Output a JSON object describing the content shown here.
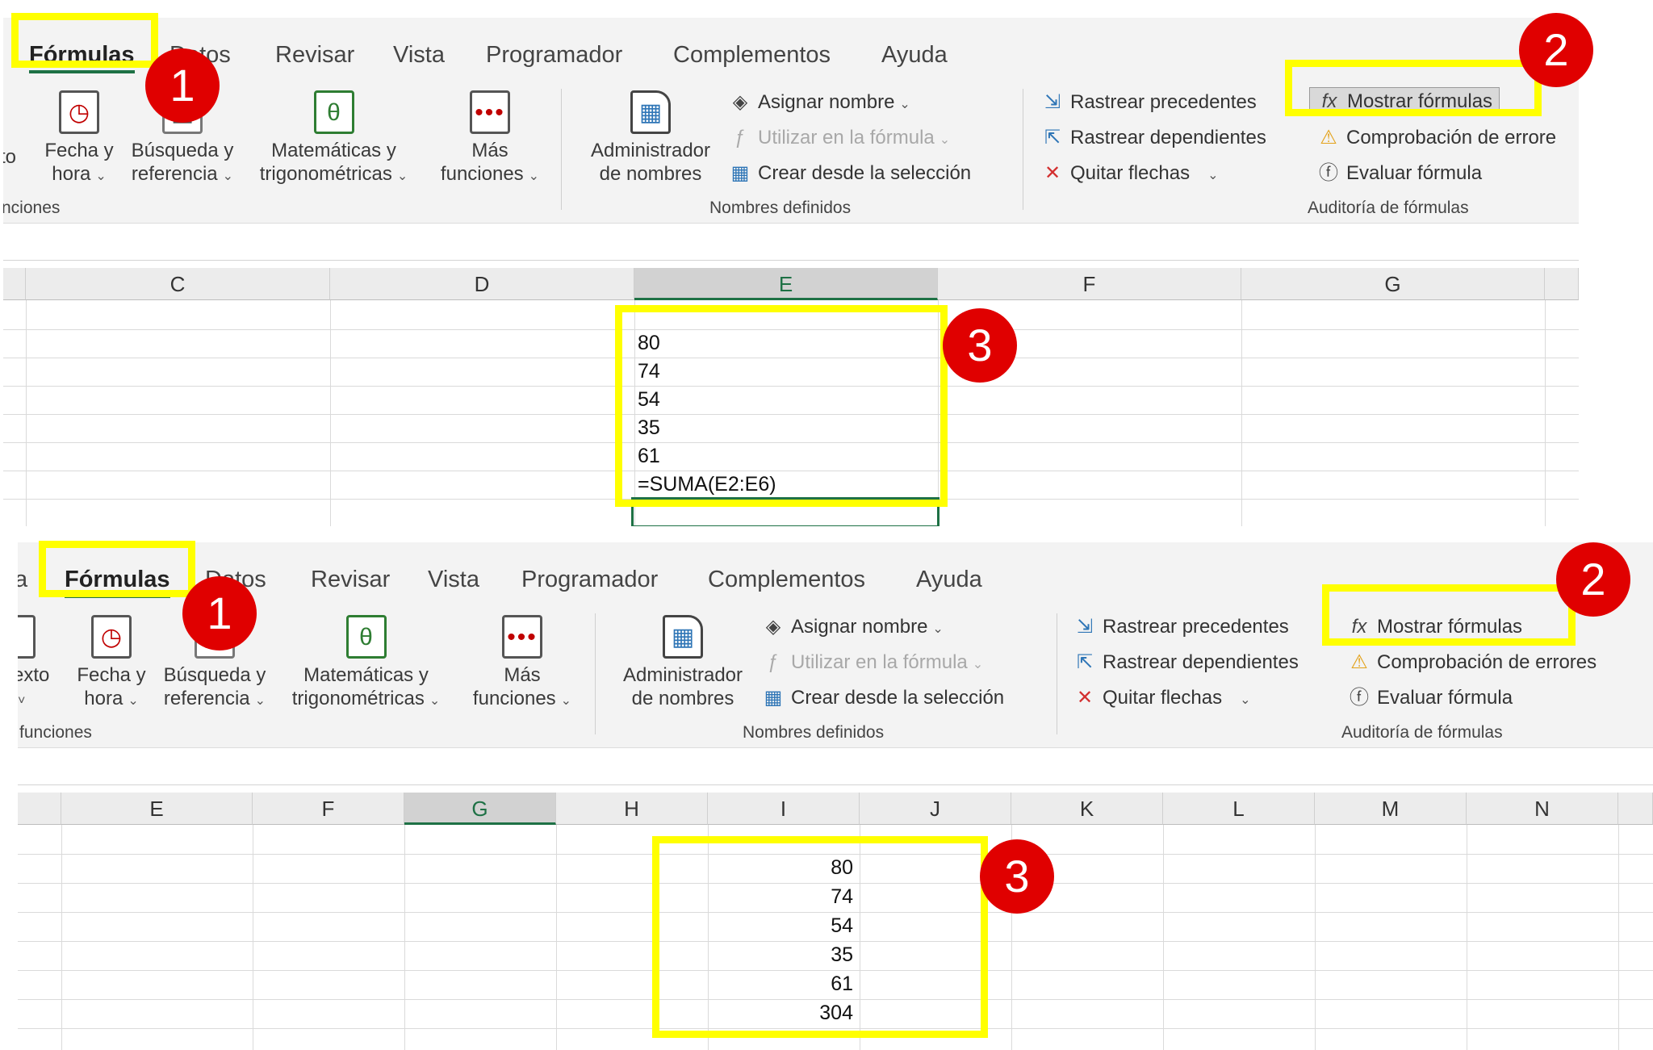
{
  "top": {
    "tabs": [
      "Fórmulas",
      "Datos",
      "Revisar",
      "Vista",
      "Programador",
      "Complementos",
      "Ayuda"
    ],
    "functions_group": {
      "partial_left_label": "to",
      "fecha": [
        "Fecha y",
        "hora"
      ],
      "busqueda": [
        "Búsqueda y",
        "referencia"
      ],
      "matematicas": [
        "Matemáticas y",
        "trigonométricas"
      ],
      "mas": [
        "Más",
        "funciones"
      ],
      "group_label": "nciones"
    },
    "names_group": {
      "admin": [
        "Administrador",
        "de nombres"
      ],
      "asignar": "Asignar nombre",
      "utilizar": "Utilizar en la fórmula",
      "crear": "Crear desde la selección",
      "group_label": "Nombres definidos"
    },
    "audit_group": {
      "precedentes": "Rastrear precedentes",
      "dependientes": "Rastrear dependientes",
      "quitar": "Quitar flechas",
      "mostrar": "Mostrar fórmulas",
      "comprobacion": "Comprobación de errore",
      "evaluar": "Evaluar fórmula",
      "group_label": "Auditoría de fórmulas"
    },
    "columns": [
      "C",
      "D",
      "E",
      "F",
      "G"
    ],
    "cells": [
      "80",
      "74",
      "54",
      "35",
      "61",
      "=SUMA(E2:E6)"
    ]
  },
  "bottom": {
    "tabs": [
      "a",
      "Fórmulas",
      "Datos",
      "Revisar",
      "Vista",
      "Programador",
      "Complementos",
      "Ayuda"
    ],
    "functions_group": {
      "partial_left_label": [
        "exto",
        "˅"
      ],
      "fecha": [
        "Fecha y",
        "hora"
      ],
      "busqueda": [
        "Búsqueda y",
        "referencia"
      ],
      "matematicas": [
        "Matemáticas y",
        "trigonométricas"
      ],
      "mas": [
        "Más",
        "funciones"
      ],
      "group_label": "funciones"
    },
    "names_group": {
      "admin": [
        "Administrador",
        "de nombres"
      ],
      "asignar": "Asignar nombre",
      "utilizar": "Utilizar en la fórmula",
      "crear": "Crear desde la selección",
      "group_label": "Nombres definidos"
    },
    "audit_group": {
      "precedentes": "Rastrear precedentes",
      "dependientes": "Rastrear dependientes",
      "quitar": "Quitar flechas",
      "mostrar": "Mostrar fórmulas",
      "comprobacion": "Comprobación de errores",
      "evaluar": "Evaluar fórmula",
      "group_label": "Auditoría de fórmulas"
    },
    "columns": [
      "E",
      "F",
      "G",
      "H",
      "I",
      "J",
      "K",
      "L",
      "M",
      "N"
    ],
    "cells": [
      "80",
      "74",
      "54",
      "35",
      "61",
      "304"
    ]
  },
  "badges": [
    "1",
    "2",
    "3",
    "1",
    "2",
    "3"
  ],
  "colors": {
    "highlight": "#ffff00",
    "badge": "#e00000",
    "excel_green": "#1e7145"
  }
}
